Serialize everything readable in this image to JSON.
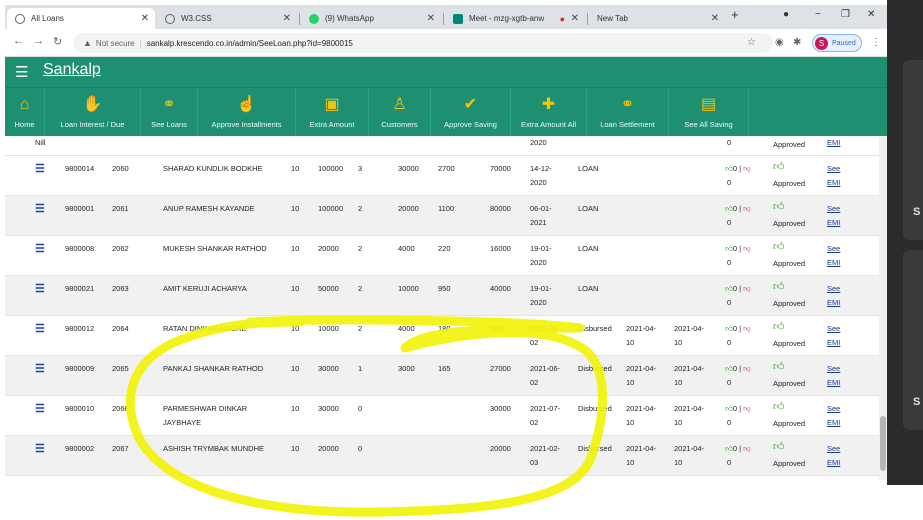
{
  "browser": {
    "tabs": [
      {
        "title": "All Loans",
        "icon": "globe-icon",
        "color": "#5f6368"
      },
      {
        "title": "W3.CSS",
        "icon": "globe-icon",
        "color": "#5f6368"
      },
      {
        "title": "(9) WhatsApp",
        "icon": "whatsapp-icon",
        "color": "#25d366"
      },
      {
        "title": "Meet - mzg-xgtb-anw",
        "icon": "meet-icon",
        "color": "#00897b"
      },
      {
        "title": "New Tab",
        "icon": "",
        "color": ""
      }
    ],
    "address": {
      "security_label": "Not secure",
      "url": "sankalp.krescendo.co.in/admin/SeeLoan.php?id=9800015"
    },
    "profile_label": "Paused",
    "profile_initial": "S"
  },
  "app": {
    "brand": "Sankalp",
    "accent_color": "#1f8f72",
    "nav": [
      {
        "label": "Home",
        "icon": "home-icon"
      },
      {
        "label": "Loan Interest / Due",
        "icon": "hand-icon"
      },
      {
        "label": "See Loans",
        "icon": "handshake-icon"
      },
      {
        "label": "Approve Installments",
        "icon": "hand-holding-icon"
      },
      {
        "label": "Extra Amount",
        "icon": "briefcase-icon"
      },
      {
        "label": "Customers",
        "icon": "user-icon"
      },
      {
        "label": "Approve Saving",
        "icon": "check-circle-icon"
      },
      {
        "label": "Extra Amount All",
        "icon": "gift-icon"
      },
      {
        "label": "Loan Settlement",
        "icon": "handshake-icon"
      },
      {
        "label": "See All Saving",
        "icon": "save-icon"
      }
    ]
  },
  "table": {
    "top_row": {
      "col1": "Nill",
      "date": "2020",
      "count": "0",
      "status": "Approved",
      "emi": "EMI"
    },
    "rows": [
      {
        "id": "9800014",
        "loan_no": "2060",
        "name": "SHARAD KUNDLIK BODKHE",
        "rate": "10",
        "amount": "100000",
        "n": "3",
        "a": "30000",
        "b": "2700",
        "c": "70000",
        "date1": "14-12-2020",
        "type": "LOAN",
        "date2": "",
        "date3": "",
        "likes": "0",
        "count": "0",
        "status": "Approved",
        "see": "See",
        "emi": "EMI"
      },
      {
        "id": "9800001",
        "loan_no": "2061",
        "name": "ANUP RAMESH KAYANDE",
        "rate": "10",
        "amount": "100000",
        "n": "2",
        "a": "20000",
        "b": "1100",
        "c": "80000",
        "date1": "06-01-2021",
        "type": "LOAN",
        "date2": "",
        "date3": "",
        "likes": "0",
        "count": "0",
        "status": "Approved",
        "see": "See",
        "emi": "EMI"
      },
      {
        "id": "9800008",
        "loan_no": "2062",
        "name": "MUKESH SHANKAR RATHOD",
        "rate": "10",
        "amount": "20000",
        "n": "2",
        "a": "4000",
        "b": "220",
        "c": "16000",
        "date1": "19-01-2020",
        "type": "LOAN",
        "date2": "",
        "date3": "",
        "likes": "0",
        "count": "0",
        "status": "Approved",
        "see": "See",
        "emi": "EMI"
      },
      {
        "id": "9800021",
        "loan_no": "2063",
        "name": "AMIT KERUJI ACHARYA",
        "rate": "10",
        "amount": "50000",
        "n": "2",
        "a": "10000",
        "b": "950",
        "c": "40000",
        "date1": "19-01-2020",
        "type": "LOAN",
        "date2": "",
        "date3": "",
        "likes": "0",
        "count": "0",
        "status": "Approved",
        "see": "See",
        "emi": "EMI"
      },
      {
        "id": "9800012",
        "loan_no": "2064",
        "name": "RATAN DINKAR NAGRE",
        "rate": "10",
        "amount": "10000",
        "n": "2",
        "a": "4000",
        "b": "180",
        "c": "6000",
        "date1": "2021-06-02",
        "type": "Disbursed",
        "date2": "2021-04-10",
        "date3": "2021-04-10",
        "likes": "0",
        "count": "0",
        "status": "Approved",
        "see": "See",
        "emi": "EMI"
      },
      {
        "id": "9800009",
        "loan_no": "2065",
        "name": "PANKAJ SHANKAR RATHOD",
        "rate": "10",
        "amount": "30000",
        "n": "1",
        "a": "3000",
        "b": "165",
        "c": "27000",
        "date1": "2021-06-02",
        "type": "Disbursed",
        "date2": "2021-04-10",
        "date3": "2021-04-10",
        "likes": "0",
        "count": "0",
        "status": "Approved",
        "see": "See",
        "emi": "EMI"
      },
      {
        "id": "9800010",
        "loan_no": "2066",
        "name": "PARMESHWAR DINKAR JAYBHAYE",
        "rate": "10",
        "amount": "30000",
        "n": "0",
        "a": "",
        "b": "",
        "c": "30000",
        "date1": "2021-07-02",
        "type": "Disbursed",
        "date2": "2021-04-10",
        "date3": "2021-04-10",
        "likes": "0",
        "count": "0",
        "status": "Approved",
        "see": "See",
        "emi": "EMI"
      },
      {
        "id": "9800002",
        "loan_no": "2067",
        "name": "ASHISH TRYMBAK MUNDHE",
        "rate": "10",
        "amount": "20000",
        "n": "0",
        "a": "",
        "b": "",
        "c": "20000",
        "date1": "2021-02-03",
        "type": "Disbursed",
        "date2": "2021-04-10",
        "date3": "2021-04-10",
        "likes": "0",
        "count": "0",
        "status": "Approved",
        "see": "See",
        "emi": "EMI"
      }
    ]
  },
  "side_panel": {
    "letter1": "S",
    "letter2": "S"
  },
  "highlight_color": "#f2f20a"
}
